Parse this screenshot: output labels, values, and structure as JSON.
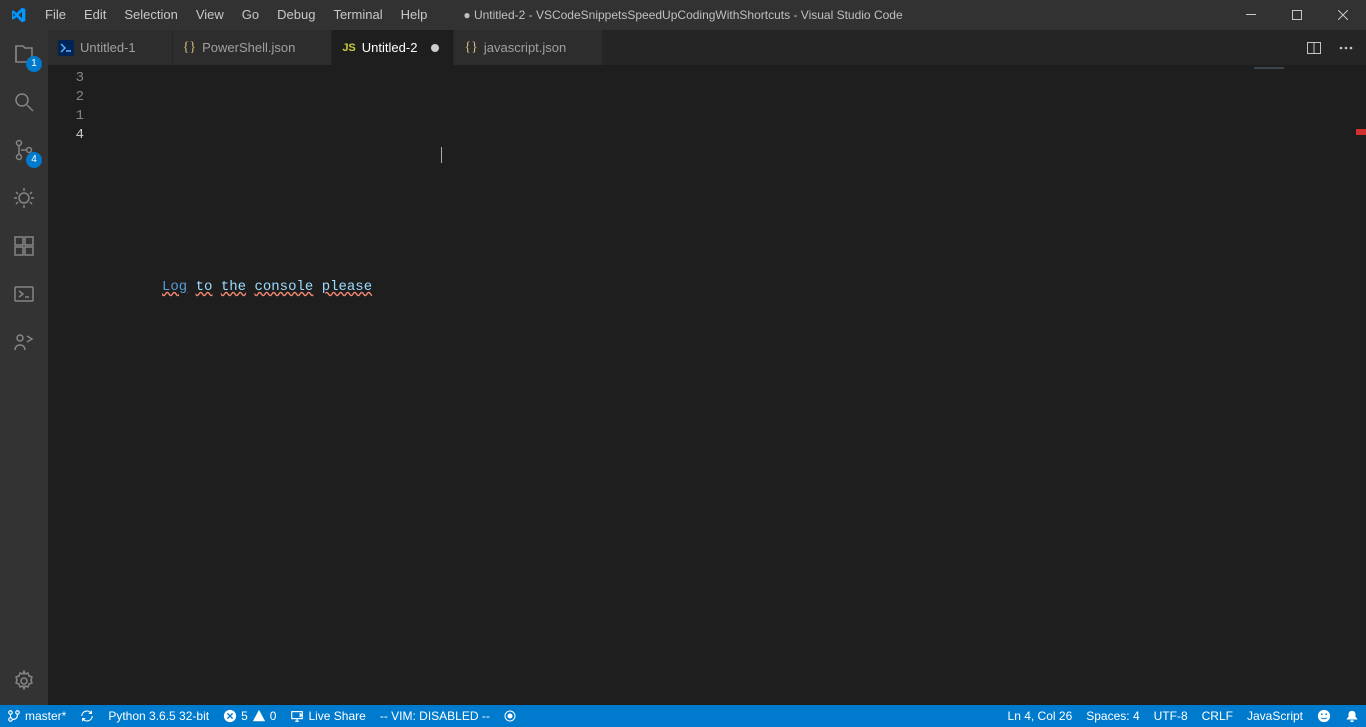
{
  "window": {
    "title": "● Untitled-2 - VSCodeSnippetsSpeedUpCodingWithShortcuts - Visual Studio Code"
  },
  "menu": {
    "items": [
      "File",
      "Edit",
      "Selection",
      "View",
      "Go",
      "Debug",
      "Terminal",
      "Help"
    ]
  },
  "activity": {
    "explorer_badge": "1",
    "scm_badge": "4"
  },
  "tabs": {
    "items": [
      {
        "label": "Untitled-1",
        "icon": "powershell",
        "dirty": false,
        "active": false
      },
      {
        "label": "PowerShell.json",
        "icon": "json",
        "dirty": false,
        "active": false
      },
      {
        "label": "Untitled-2",
        "icon": "js",
        "dirty": true,
        "active": true
      },
      {
        "label": "javascript.json",
        "icon": "json",
        "dirty": false,
        "active": false
      }
    ]
  },
  "editor": {
    "line_numbers": [
      "3",
      "2",
      "1",
      "4"
    ],
    "current_line_index": 3,
    "code_tokens": [
      {
        "text": "Log",
        "cls": "tok-key tok-err"
      },
      {
        "text": " ",
        "cls": ""
      },
      {
        "text": "to",
        "cls": "tok-txt tok-err"
      },
      {
        "text": " ",
        "cls": ""
      },
      {
        "text": "the",
        "cls": "tok-txt tok-err"
      },
      {
        "text": " ",
        "cls": ""
      },
      {
        "text": "console",
        "cls": "tok-txt tok-err"
      },
      {
        "text": " ",
        "cls": ""
      },
      {
        "text": "please",
        "cls": "tok-txt tok-err"
      }
    ]
  },
  "status": {
    "branch": "master*",
    "python": "Python 3.6.5 32-bit",
    "errors": "5",
    "warnings": "0",
    "live_share": "Live Share",
    "vim": "-- VIM: DISABLED --",
    "ln_col": "Ln 4, Col 26",
    "spaces": "Spaces: 4",
    "encoding": "UTF-8",
    "eol": "CRLF",
    "language": "JavaScript"
  }
}
